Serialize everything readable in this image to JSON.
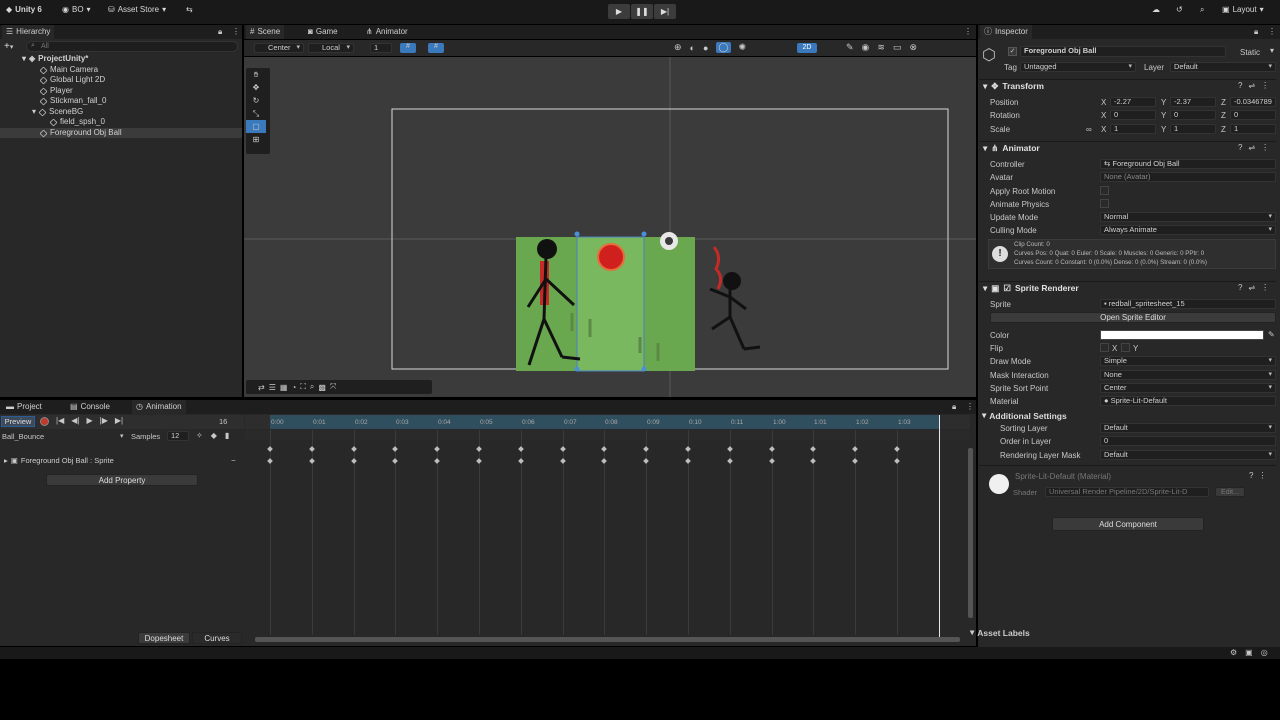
{
  "topbar": {
    "app": "Unity 6",
    "account": "BO",
    "asset_store": "Asset Store",
    "layout": "Layout"
  },
  "hierarchy": {
    "title": "Hierarchy",
    "search_placeholder": "All",
    "items": [
      {
        "label": "ProjectUnity*"
      },
      {
        "label": "Main Camera"
      },
      {
        "label": "Global Light 2D"
      },
      {
        "label": "Player"
      },
      {
        "label": "Stickman_fall_0"
      },
      {
        "label": "SceneBG"
      },
      {
        "label": "field_spsh_0"
      },
      {
        "label": "Foreground Obj Ball"
      }
    ]
  },
  "scene": {
    "tabs": [
      "Scene",
      "Game",
      "Animator"
    ],
    "pivot": "Center",
    "space": "Local",
    "snap": "1",
    "mode_2d": "2D"
  },
  "bottom": {
    "tabs": [
      "Project",
      "Console",
      "Animation"
    ],
    "preview": "Preview",
    "frame": "16",
    "clip": "Ball_Bounce",
    "samples_label": "Samples",
    "samples": "12",
    "property": "Foreground Obj Ball : Sprite",
    "add_property": "Add Property",
    "dopesheet": "Dopesheet",
    "curves": "Curves",
    "ticks": [
      "0:00",
      "0:01",
      "0:02",
      "0:03",
      "0:04",
      "0:05",
      "0:06",
      "0:07",
      "0:08",
      "0:09",
      "0:10",
      "0:11",
      "1:00",
      "1:01",
      "1:02",
      "1:03"
    ]
  },
  "inspector": {
    "title": "Inspector",
    "object_name": "Foreground Obj Ball",
    "static": "Static",
    "tag_label": "Tag",
    "tag": "Untagged",
    "layer_label": "Layer",
    "layer": "Default",
    "transform": {
      "title": "Transform",
      "position_label": "Position",
      "rotation_label": "Rotation",
      "scale_label": "Scale",
      "pos_x": "-2.27",
      "pos_y": "-2.37",
      "pos_z": "-0.0346789",
      "rot_x": "0",
      "rot_y": "0",
      "rot_z": "0",
      "scl_x": "1",
      "scl_y": "1",
      "scl_z": "1"
    },
    "animator": {
      "title": "Animator",
      "controller_label": "Controller",
      "controller": "Foreground Obj Ball",
      "avatar_label": "Avatar",
      "avatar": "None (Avatar)",
      "root_motion_label": "Apply Root Motion",
      "animate_physics_label": "Animate Physics",
      "update_mode_label": "Update Mode",
      "update_mode": "Normal",
      "culling_mode_label": "Culling Mode",
      "culling_mode": "Always Animate",
      "info_line1": "Clip Count: 0",
      "info_line2": "Curves Pos: 0 Quat: 0 Euler: 0 Scale: 0 Muscles: 0 Generic: 0 PPtr: 0",
      "info_line3": "Curves Count: 0 Constant: 0 (0.0%) Dense: 0 (0.0%) Stream: 0 (0.0%)"
    },
    "sprite_renderer": {
      "title": "Sprite Renderer",
      "sprite_label": "Sprite",
      "sprite": "redball_spritesheet_15",
      "open_editor": "Open Sprite Editor",
      "color_label": "Color",
      "flip_label": "Flip",
      "flip_x": "X",
      "flip_y": "Y",
      "draw_mode_label": "Draw Mode",
      "draw_mode": "Simple",
      "mask_label": "Mask Interaction",
      "mask": "None",
      "sort_point_label": "Sprite Sort Point",
      "sort_point": "Center",
      "material_label": "Material",
      "material": "Sprite-Lit-Default",
      "additional": "Additional Settings",
      "sorting_layer_label": "Sorting Layer",
      "sorting_layer": "Default",
      "order_label": "Order in Layer",
      "order": "0",
      "rendering_mask_label": "Rendering Layer Mask",
      "rendering_mask": "Default"
    },
    "material_block": {
      "name": "Sprite-Lit-Default (Material)",
      "shader_label": "Shader",
      "shader": "Universal Render Pipeline/2D/Sprite-Lit-D",
      "edit": "Edit..."
    },
    "add_component": "Add Component",
    "asset_labels": "Asset Labels"
  },
  "colors": {
    "accent": "#3a79bb",
    "field_green": "#6aa84f",
    "ball_red": "#d0201e"
  }
}
